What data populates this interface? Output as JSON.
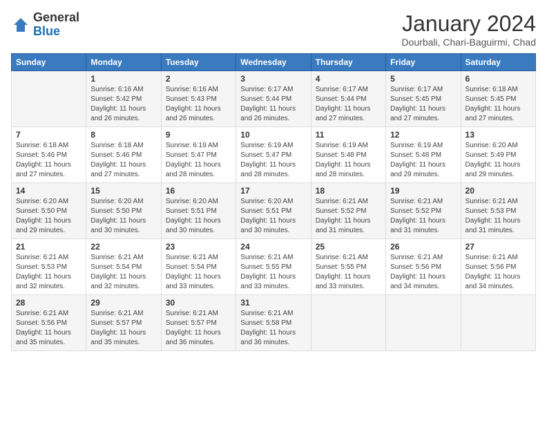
{
  "logo": {
    "general": "General",
    "blue": "Blue"
  },
  "header": {
    "title": "January 2024",
    "subtitle": "Dourbali, Chari-Baguirmi, Chad"
  },
  "weekdays": [
    "Sunday",
    "Monday",
    "Tuesday",
    "Wednesday",
    "Thursday",
    "Friday",
    "Saturday"
  ],
  "weeks": [
    [
      {
        "day": "",
        "sunrise": "",
        "sunset": "",
        "daylight": ""
      },
      {
        "day": "1",
        "sunrise": "Sunrise: 6:16 AM",
        "sunset": "Sunset: 5:42 PM",
        "daylight": "Daylight: 11 hours and 26 minutes."
      },
      {
        "day": "2",
        "sunrise": "Sunrise: 6:16 AM",
        "sunset": "Sunset: 5:43 PM",
        "daylight": "Daylight: 11 hours and 26 minutes."
      },
      {
        "day": "3",
        "sunrise": "Sunrise: 6:17 AM",
        "sunset": "Sunset: 5:44 PM",
        "daylight": "Daylight: 11 hours and 26 minutes."
      },
      {
        "day": "4",
        "sunrise": "Sunrise: 6:17 AM",
        "sunset": "Sunset: 5:44 PM",
        "daylight": "Daylight: 11 hours and 27 minutes."
      },
      {
        "day": "5",
        "sunrise": "Sunrise: 6:17 AM",
        "sunset": "Sunset: 5:45 PM",
        "daylight": "Daylight: 11 hours and 27 minutes."
      },
      {
        "day": "6",
        "sunrise": "Sunrise: 6:18 AM",
        "sunset": "Sunset: 5:45 PM",
        "daylight": "Daylight: 11 hours and 27 minutes."
      }
    ],
    [
      {
        "day": "7",
        "sunrise": "Sunrise: 6:18 AM",
        "sunset": "Sunset: 5:46 PM",
        "daylight": "Daylight: 11 hours and 27 minutes."
      },
      {
        "day": "8",
        "sunrise": "Sunrise: 6:18 AM",
        "sunset": "Sunset: 5:46 PM",
        "daylight": "Daylight: 11 hours and 27 minutes."
      },
      {
        "day": "9",
        "sunrise": "Sunrise: 6:19 AM",
        "sunset": "Sunset: 5:47 PM",
        "daylight": "Daylight: 11 hours and 28 minutes."
      },
      {
        "day": "10",
        "sunrise": "Sunrise: 6:19 AM",
        "sunset": "Sunset: 5:47 PM",
        "daylight": "Daylight: 11 hours and 28 minutes."
      },
      {
        "day": "11",
        "sunrise": "Sunrise: 6:19 AM",
        "sunset": "Sunset: 5:48 PM",
        "daylight": "Daylight: 11 hours and 28 minutes."
      },
      {
        "day": "12",
        "sunrise": "Sunrise: 6:19 AM",
        "sunset": "Sunset: 5:48 PM",
        "daylight": "Daylight: 11 hours and 29 minutes."
      },
      {
        "day": "13",
        "sunrise": "Sunrise: 6:20 AM",
        "sunset": "Sunset: 5:49 PM",
        "daylight": "Daylight: 11 hours and 29 minutes."
      }
    ],
    [
      {
        "day": "14",
        "sunrise": "Sunrise: 6:20 AM",
        "sunset": "Sunset: 5:50 PM",
        "daylight": "Daylight: 11 hours and 29 minutes."
      },
      {
        "day": "15",
        "sunrise": "Sunrise: 6:20 AM",
        "sunset": "Sunset: 5:50 PM",
        "daylight": "Daylight: 11 hours and 30 minutes."
      },
      {
        "day": "16",
        "sunrise": "Sunrise: 6:20 AM",
        "sunset": "Sunset: 5:51 PM",
        "daylight": "Daylight: 11 hours and 30 minutes."
      },
      {
        "day": "17",
        "sunrise": "Sunrise: 6:20 AM",
        "sunset": "Sunset: 5:51 PM",
        "daylight": "Daylight: 11 hours and 30 minutes."
      },
      {
        "day": "18",
        "sunrise": "Sunrise: 6:21 AM",
        "sunset": "Sunset: 5:52 PM",
        "daylight": "Daylight: 11 hours and 31 minutes."
      },
      {
        "day": "19",
        "sunrise": "Sunrise: 6:21 AM",
        "sunset": "Sunset: 5:52 PM",
        "daylight": "Daylight: 11 hours and 31 minutes."
      },
      {
        "day": "20",
        "sunrise": "Sunrise: 6:21 AM",
        "sunset": "Sunset: 5:53 PM",
        "daylight": "Daylight: 11 hours and 31 minutes."
      }
    ],
    [
      {
        "day": "21",
        "sunrise": "Sunrise: 6:21 AM",
        "sunset": "Sunset: 5:53 PM",
        "daylight": "Daylight: 11 hours and 32 minutes."
      },
      {
        "day": "22",
        "sunrise": "Sunrise: 6:21 AM",
        "sunset": "Sunset: 5:54 PM",
        "daylight": "Daylight: 11 hours and 32 minutes."
      },
      {
        "day": "23",
        "sunrise": "Sunrise: 6:21 AM",
        "sunset": "Sunset: 5:54 PM",
        "daylight": "Daylight: 11 hours and 33 minutes."
      },
      {
        "day": "24",
        "sunrise": "Sunrise: 6:21 AM",
        "sunset": "Sunset: 5:55 PM",
        "daylight": "Daylight: 11 hours and 33 minutes."
      },
      {
        "day": "25",
        "sunrise": "Sunrise: 6:21 AM",
        "sunset": "Sunset: 5:55 PM",
        "daylight": "Daylight: 11 hours and 33 minutes."
      },
      {
        "day": "26",
        "sunrise": "Sunrise: 6:21 AM",
        "sunset": "Sunset: 5:56 PM",
        "daylight": "Daylight: 11 hours and 34 minutes."
      },
      {
        "day": "27",
        "sunrise": "Sunrise: 6:21 AM",
        "sunset": "Sunset: 5:56 PM",
        "daylight": "Daylight: 11 hours and 34 minutes."
      }
    ],
    [
      {
        "day": "28",
        "sunrise": "Sunrise: 6:21 AM",
        "sunset": "Sunset: 5:56 PM",
        "daylight": "Daylight: 11 hours and 35 minutes."
      },
      {
        "day": "29",
        "sunrise": "Sunrise: 6:21 AM",
        "sunset": "Sunset: 5:57 PM",
        "daylight": "Daylight: 11 hours and 35 minutes."
      },
      {
        "day": "30",
        "sunrise": "Sunrise: 6:21 AM",
        "sunset": "Sunset: 5:57 PM",
        "daylight": "Daylight: 11 hours and 36 minutes."
      },
      {
        "day": "31",
        "sunrise": "Sunrise: 6:21 AM",
        "sunset": "Sunset: 5:58 PM",
        "daylight": "Daylight: 11 hours and 36 minutes."
      },
      {
        "day": "",
        "sunrise": "",
        "sunset": "",
        "daylight": ""
      },
      {
        "day": "",
        "sunrise": "",
        "sunset": "",
        "daylight": ""
      },
      {
        "day": "",
        "sunrise": "",
        "sunset": "",
        "daylight": ""
      }
    ]
  ]
}
